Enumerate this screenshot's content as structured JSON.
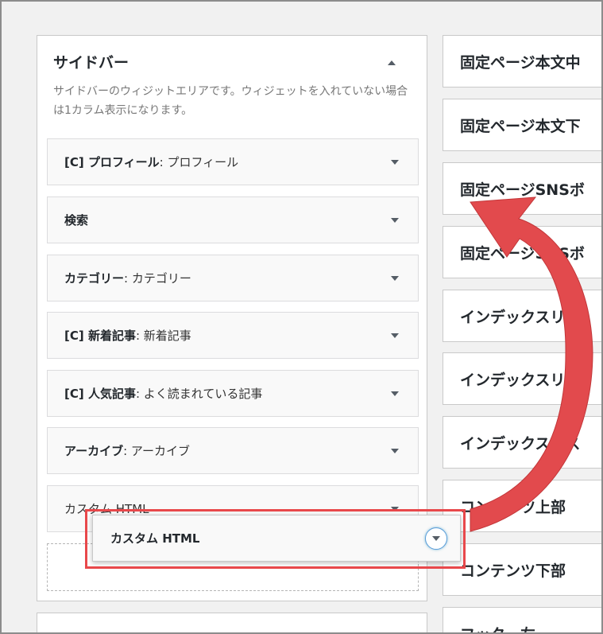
{
  "sidebar_area": {
    "title": "サイドバー",
    "description": "サイドバーのウィジットエリアです。ウィジェットを入れていない場合は1カラム表示になります。",
    "widgets": [
      {
        "title": "[C] プロフィール",
        "subtitle": ": プロフィール"
      },
      {
        "title": "検索",
        "subtitle": ""
      },
      {
        "title": "カテゴリー",
        "subtitle": ": カテゴリー"
      },
      {
        "title": "[C] 新着記事",
        "subtitle": ": 新着記事"
      },
      {
        "title": "[C] 人気記事",
        "subtitle": ": よく読まれている記事"
      },
      {
        "title": "アーカイブ",
        "subtitle": ": アーカイブ"
      },
      {
        "title": "カスタム HTML",
        "subtitle": ""
      }
    ]
  },
  "dragged_widget": {
    "title": "カスタム HTML"
  },
  "right_areas": [
    "固定ページ本文中",
    "固定ページ本文下",
    "固定ページSNSボ",
    "固定ページSNSボ",
    "インデックスリス",
    "インデックスリス",
    "インデックスリス",
    "コンテンツ上部",
    "コンテンツ下部",
    "フッター左"
  ],
  "colors": {
    "highlight": "#e8484b",
    "arrow": "#e24a4d"
  },
  "icons": {
    "area_toggle": "triangle-up-icon",
    "widget_toggle": "triangle-down-icon",
    "drag_arrow": "curved-arrow-icon"
  }
}
